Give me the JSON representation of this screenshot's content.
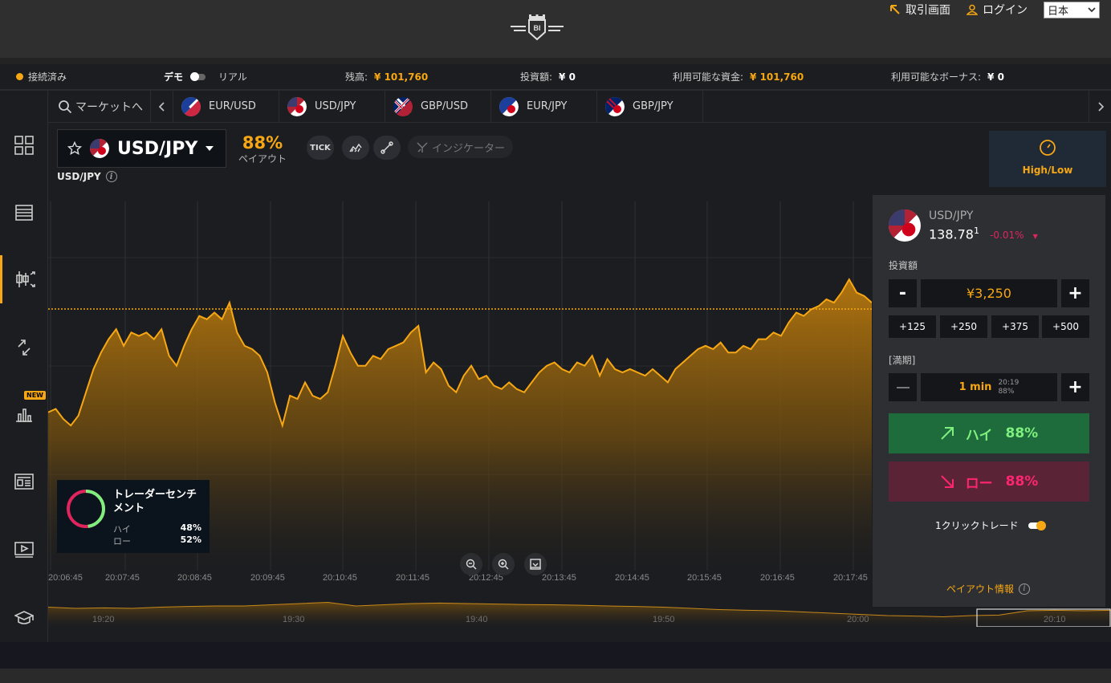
{
  "header": {
    "trade_link": "取引画面",
    "login_link": "ログイン",
    "language": "日本"
  },
  "status": {
    "connected": "接続済み",
    "demo": "デモ",
    "real": "リアル",
    "balance_label": "残高:",
    "balance_value": "¥ 101,760",
    "invest_label": "投資額:",
    "invest_value": "¥ 0",
    "available_label": "利用可能な資金:",
    "available_value": "¥ 101,760",
    "bonus_label": "利用可能なボーナス:",
    "bonus_value": "¥ 0"
  },
  "market": {
    "search_label": "マーケットへ",
    "tabs": [
      {
        "label": "EUR/USD",
        "flag": "eu-us"
      },
      {
        "label": "USD/JPY",
        "flag": "us-jp"
      },
      {
        "label": "GBP/USD",
        "flag": "gb-us"
      },
      {
        "label": "EUR/JPY",
        "flag": "eu-jp"
      },
      {
        "label": "GBP/JPY",
        "flag": "gb-jp"
      }
    ]
  },
  "asset": {
    "name": "USD/JPY",
    "payout_pct": "88%",
    "payout_label": "ペイアウト",
    "chart_label": "USD/JPY",
    "tick_btn": "TICK",
    "indicator_btn": "インジケーター"
  },
  "chart_data": {
    "type": "area",
    "x_labels": [
      "20:06:45",
      "20:07:45",
      "20:08:45",
      "20:09:45",
      "20:10:45",
      "20:11:45",
      "20:12:45",
      "20:13:45",
      "20:14:45",
      "20:15:45",
      "20:16:45",
      "20:17:45"
    ],
    "mini_x_labels": [
      "19:20",
      "19:30",
      "19:40",
      "19:50",
      "20:00",
      "20:10"
    ],
    "values": [
      0.38,
      0.39,
      0.36,
      0.34,
      0.37,
      0.44,
      0.51,
      0.56,
      0.6,
      0.63,
      0.58,
      0.62,
      0.61,
      0.62,
      0.6,
      0.63,
      0.55,
      0.52,
      0.58,
      0.63,
      0.67,
      0.66,
      0.68,
      0.66,
      0.71,
      0.62,
      0.58,
      0.57,
      0.55,
      0.5,
      0.41,
      0.34,
      0.43,
      0.42,
      0.47,
      0.43,
      0.42,
      0.44,
      0.52,
      0.61,
      0.56,
      0.52,
      0.52,
      0.55,
      0.54,
      0.57,
      0.58,
      0.59,
      0.62,
      0.64,
      0.5,
      0.53,
      0.51,
      0.46,
      0.44,
      0.49,
      0.52,
      0.48,
      0.49,
      0.46,
      0.45,
      0.47,
      0.45,
      0.44,
      0.47,
      0.5,
      0.52,
      0.53,
      0.51,
      0.5,
      0.53,
      0.52,
      0.55,
      0.49,
      0.54,
      0.51,
      0.5,
      0.51,
      0.5,
      0.49,
      0.51,
      0.49,
      0.47,
      0.51,
      0.53,
      0.55,
      0.57,
      0.58,
      0.57,
      0.59,
      0.56,
      0.56,
      0.58,
      0.57,
      0.6,
      0.6,
      0.62,
      0.61,
      0.65,
      0.68,
      0.67,
      0.69,
      0.7,
      0.72,
      0.71,
      0.74,
      0.78,
      0.74,
      0.73,
      0.71
    ]
  },
  "sentiment": {
    "title": "トレーダーセンチメント",
    "high_label": "ハイ",
    "high_pct": "48%",
    "low_label": "ロー",
    "low_pct": "52%",
    "high_fraction": 0.48
  },
  "panel": {
    "tab_label": "High/Low",
    "asset_name": "USD/JPY",
    "price_main": "138.78",
    "price_sup": "1",
    "change": "-0.01%",
    "invest_label": "投資額",
    "amount": "¥3,250",
    "minus": "-",
    "plus": "+",
    "quick": [
      "+125",
      "+250",
      "+375",
      "+500"
    ],
    "expiry_label": "[満期]",
    "expiry_value": "1 min",
    "expiry_time": "20:19",
    "expiry_pct": "88%",
    "high_btn": "ハイ",
    "high_pct": "88%",
    "low_btn": "ロー",
    "low_pct": "88%",
    "one_click": "1クリックトレード",
    "payout_info": "ペイアウト情報"
  },
  "colors": {
    "accent": "#f7a713",
    "high": "#1e6b3c",
    "low": "#5a2436"
  }
}
